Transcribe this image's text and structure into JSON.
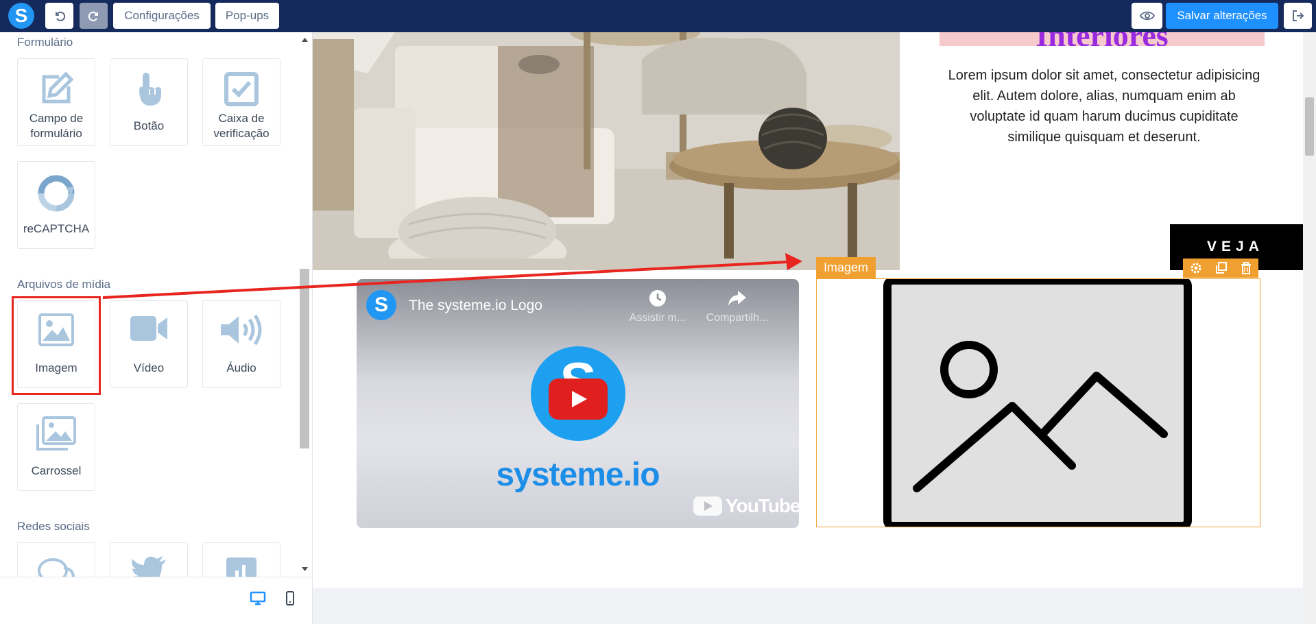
{
  "topbar": {
    "logo_letter": "S",
    "configuracoes_label": "Configurações",
    "popups_label": "Pop-ups",
    "save_label": "Salvar alterações"
  },
  "sidebar": {
    "sections": {
      "formulario": "Formulário",
      "midia": "Arquivos de mídia",
      "redes": "Redes sociais"
    },
    "form_items": [
      "Campo de formulário",
      "Botão",
      "Caixa de verificação",
      "reCAPTCHA"
    ],
    "media_items": [
      "Imagem",
      "Vídeo",
      "Áudio",
      "Carrossel"
    ]
  },
  "canvas": {
    "title_fragment": "Interiores",
    "lorem": "Lorem ipsum dolor sit amet, consectetur adipisicing elit. Autem dolore, alias, numquam enim ab voluptate id quam harum ducimus cupiditate similique quisquam et deserunt.",
    "veja": "VEJA",
    "video": {
      "title": "The systeme.io Logo",
      "watch_later": "Assistir m...",
      "share": "Compartilh...",
      "brand": "systeme.io",
      "youtube": "YouTube"
    },
    "image_label": "Imagem"
  },
  "colors": {
    "topbar": "#14295c",
    "accent": "#1e90ff",
    "selection": "#f0a030",
    "highlight_red": "#e8251f",
    "icon_blue": "#a9c6de"
  }
}
